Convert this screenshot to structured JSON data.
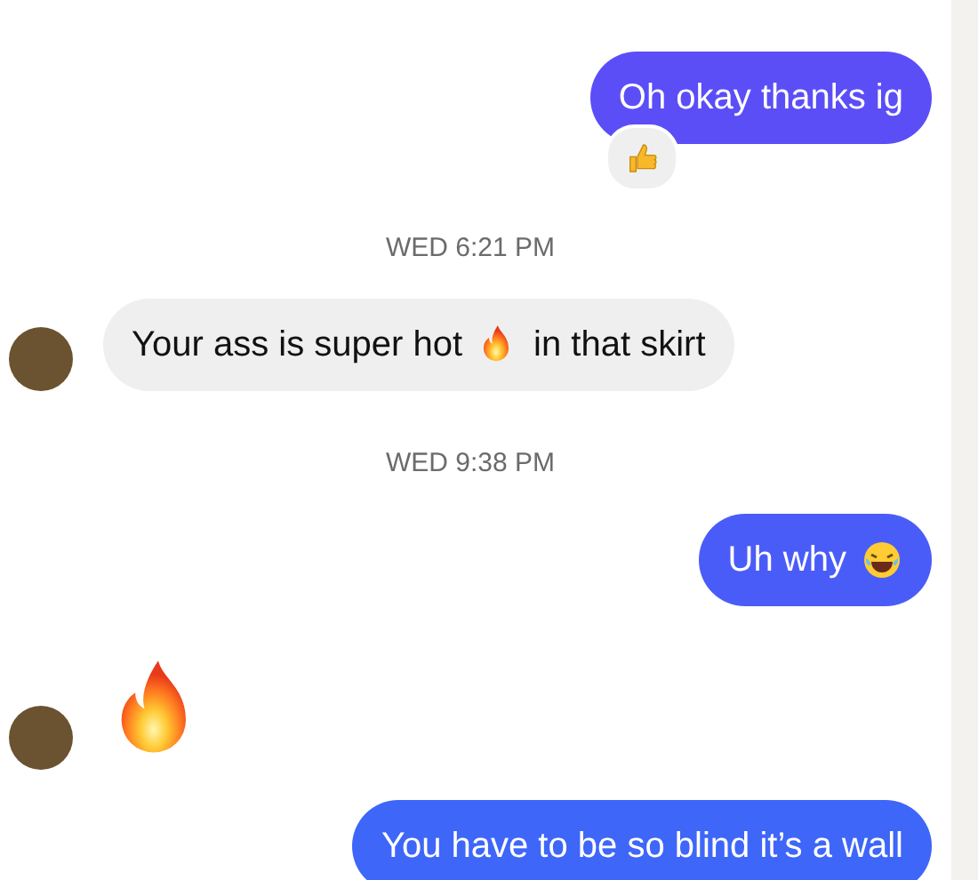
{
  "thread": [
    {
      "kind": "message",
      "outgoing": true,
      "color": "#5b4ef7",
      "reacted": true,
      "parts": [
        {
          "kind": "text",
          "text": "Oh okay thanks ig"
        }
      ]
    },
    {
      "kind": "time",
      "text": "WED 6:21 PM"
    },
    {
      "kind": "message",
      "outgoing": false,
      "reacted": false,
      "parts": [
        {
          "kind": "text",
          "text": "Your ass is super hot"
        },
        {
          "kind": "flame"
        },
        {
          "kind": "text",
          "text": "in that skirt"
        }
      ]
    },
    {
      "kind": "time",
      "text": "WED 9:38 PM"
    },
    {
      "kind": "message",
      "outgoing": true,
      "color": "#4a5cf8",
      "reacted": false,
      "parts": [
        {
          "kind": "text",
          "text": "Uh why"
        },
        {
          "kind": "laugh"
        }
      ]
    },
    {
      "kind": "big-flame",
      "outgoing": false
    },
    {
      "kind": "message",
      "outgoing": true,
      "color": "#3e66f9",
      "reacted": false,
      "parts": [
        {
          "kind": "text",
          "text": "You have to be so blind it’s a wall"
        }
      ]
    }
  ]
}
